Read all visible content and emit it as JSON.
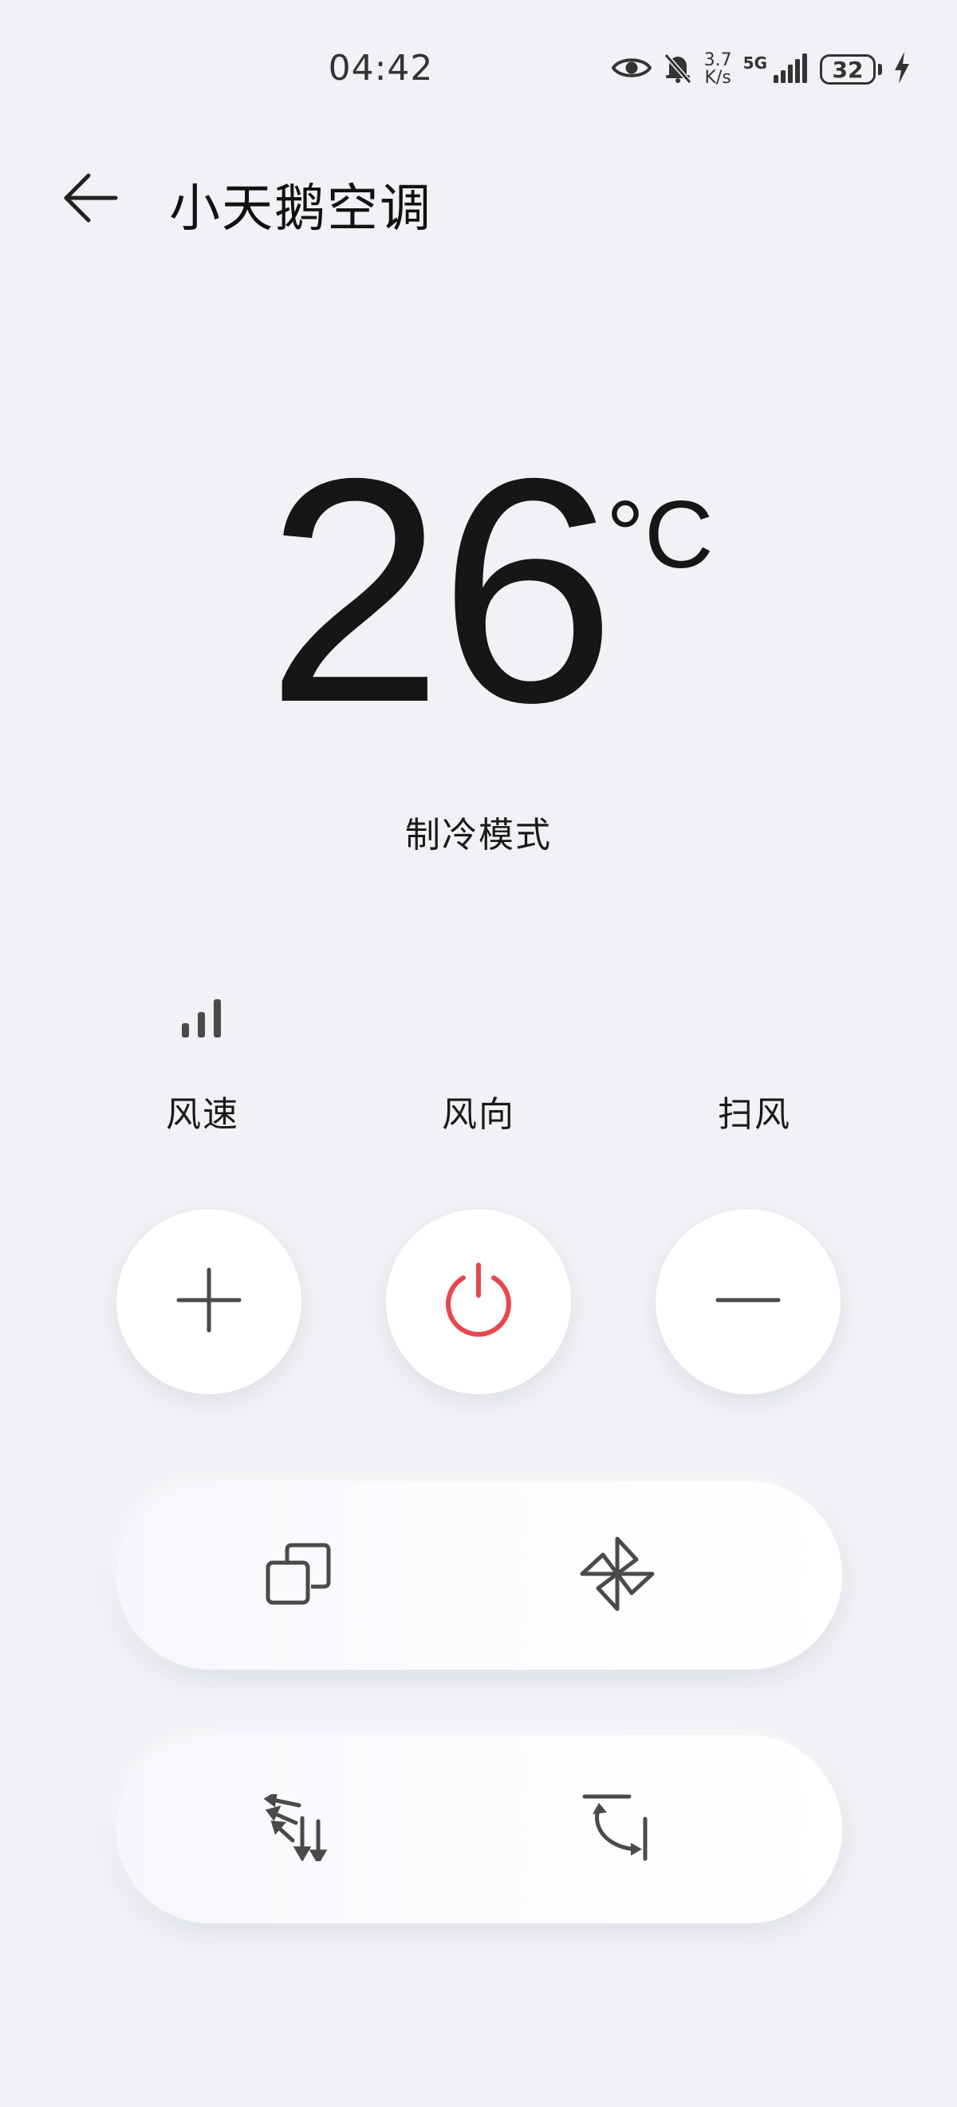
{
  "status_bar": {
    "time": "04:42",
    "net_speed_value": "3.7",
    "net_speed_unit": "K/s",
    "network_type": "5G",
    "battery_level": "32",
    "icons": [
      "eye-icon",
      "bell-muted-icon",
      "signal-icon",
      "battery-icon",
      "charging-bolt-icon"
    ]
  },
  "header": {
    "title": "小天鹅空调",
    "back_icon": "arrow-left-icon"
  },
  "temperature": {
    "value": "26",
    "unit": "°C"
  },
  "mode": {
    "label": "制冷模式"
  },
  "status_row": {
    "speed_icon": "fan-speed-bars-icon",
    "labels": [
      "风速",
      "风向",
      "扫风"
    ]
  },
  "controls": {
    "round_buttons": [
      "plus-icon",
      "power-icon",
      "minus-icon"
    ],
    "pill_1": [
      "mode-copy-icon",
      "fan-pinwheel-icon"
    ],
    "pill_2": [
      "wind-direction-icon",
      "sweep-icon"
    ]
  },
  "colors": {
    "background": "#f1f2f5",
    "power_accent": "#e8474d",
    "icon": "#4a4a4a",
    "button_bg": "#ffffff"
  }
}
